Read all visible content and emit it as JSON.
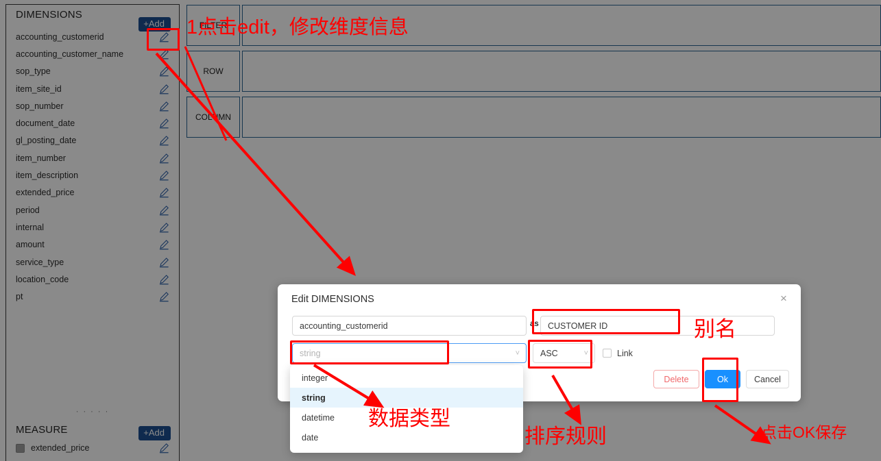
{
  "panels": {
    "dimensions": {
      "title": "DIMENSIONS",
      "add_label": "+Add",
      "fields": [
        "accounting_customerid",
        "accounting_customer_name",
        "sop_type",
        "item_site_id",
        "sop_number",
        "document_date",
        "gl_posting_date",
        "item_number",
        "item_description",
        "extended_price",
        "period",
        "internal",
        "amount",
        "service_type",
        "location_code",
        "pt"
      ]
    },
    "measure": {
      "title": "MEASURE",
      "add_label": "+Add",
      "fields": [
        "extended_price"
      ]
    }
  },
  "dropzones": [
    {
      "label": "FILTER"
    },
    {
      "label": "ROW"
    },
    {
      "label": "COLUMN"
    }
  ],
  "dialog": {
    "title": "Edit DIMENSIONS",
    "close_icon": "×",
    "expression_value": "accounting_customerid",
    "as_label": "as",
    "alias_value": "CUSTOMER ID",
    "type_placeholder": "string",
    "order_value": "ASC",
    "link_label": "Link",
    "buttons": {
      "delete": "Delete",
      "ok": "Ok",
      "cancel": "Cancel"
    },
    "type_options": [
      "integer",
      "string",
      "datetime",
      "date"
    ],
    "type_selected": "string"
  },
  "annotations": {
    "step1": "1点击edit，修改维度信息",
    "alias": "别名",
    "datatype": "数据类型",
    "sort_rule": "排序规则",
    "save": "点击OK保存"
  },
  "colors": {
    "accent_blue": "#1890ff",
    "panel_button_blue": "#1d4f91",
    "annotation_red": "#fe0000",
    "dropzone_border": "#2a6492",
    "delete_red": "#f0686b",
    "menu_selected_bg": "#e6f4fd"
  }
}
